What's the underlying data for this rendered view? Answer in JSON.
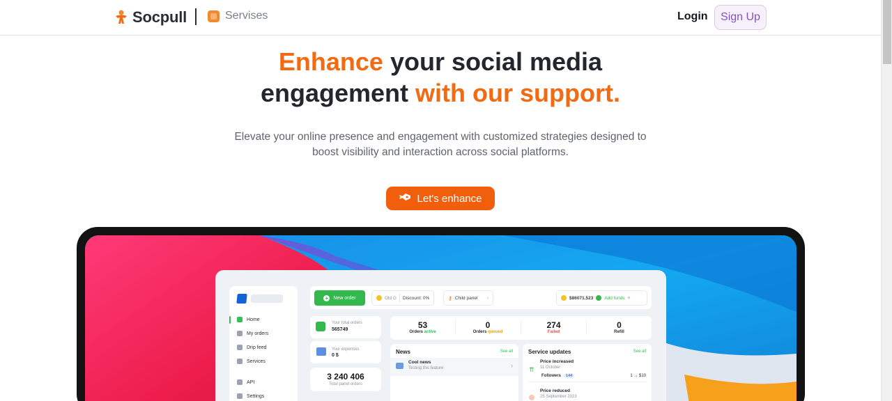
{
  "header": {
    "brand": "Socpull",
    "services_label": "Servises",
    "login_label": "Login",
    "signup_label": "Sign Up"
  },
  "hero": {
    "title_part1": "Enhance",
    "title_part2": " your social media",
    "title_part3": "engagement ",
    "title_part4": "with our support.",
    "subtitle_line1": "Elevate your online presence and engagement with customized strategies designed to",
    "subtitle_line2": "boost visibility and interaction across social platforms.",
    "cta_label": "Let's enhance"
  },
  "dashboard": {
    "nav": [
      "Home",
      "My orders",
      "Drip feed",
      "Services",
      "API",
      "Settings"
    ],
    "new_order": "New order",
    "user_chip": "Old G",
    "discount": "Discount: 0%",
    "child_panel": "Child panel",
    "balance": "$86071.523",
    "add_funds": "Add funds",
    "total_orders_label": "Your total orders",
    "total_orders_value": "565749",
    "expenses_label": "Your expenses",
    "expenses_value": "0 $",
    "panel_orders_value": "3 240 406",
    "panel_orders_label": "Total panel orders",
    "stats": [
      {
        "value": "53",
        "label": "Orders",
        "status": "active"
      },
      {
        "value": "0",
        "label": "Orders",
        "status": "queued"
      },
      {
        "value": "274",
        "label": "",
        "status": "Failed"
      },
      {
        "value": "0",
        "label": "Refill",
        "status": ""
      }
    ],
    "news_title": "News",
    "news_see_all": "See all",
    "news_item_title": "Cool news",
    "news_item_sub": "Testing this feature",
    "updates_title": "Service updates",
    "updates_see_all": "See all",
    "update1_title": "Price increased",
    "update1_date": "11 October",
    "update1_service": "Followers",
    "update1_badge": "144",
    "update1_change": "1 → $10",
    "update2_title": "Price reduced",
    "update2_date": "25 September 2023"
  },
  "colors": {
    "accent": "#f26a12",
    "cta": "#f25f0c",
    "signup_text": "#8552c4",
    "green": "#33b84c"
  }
}
